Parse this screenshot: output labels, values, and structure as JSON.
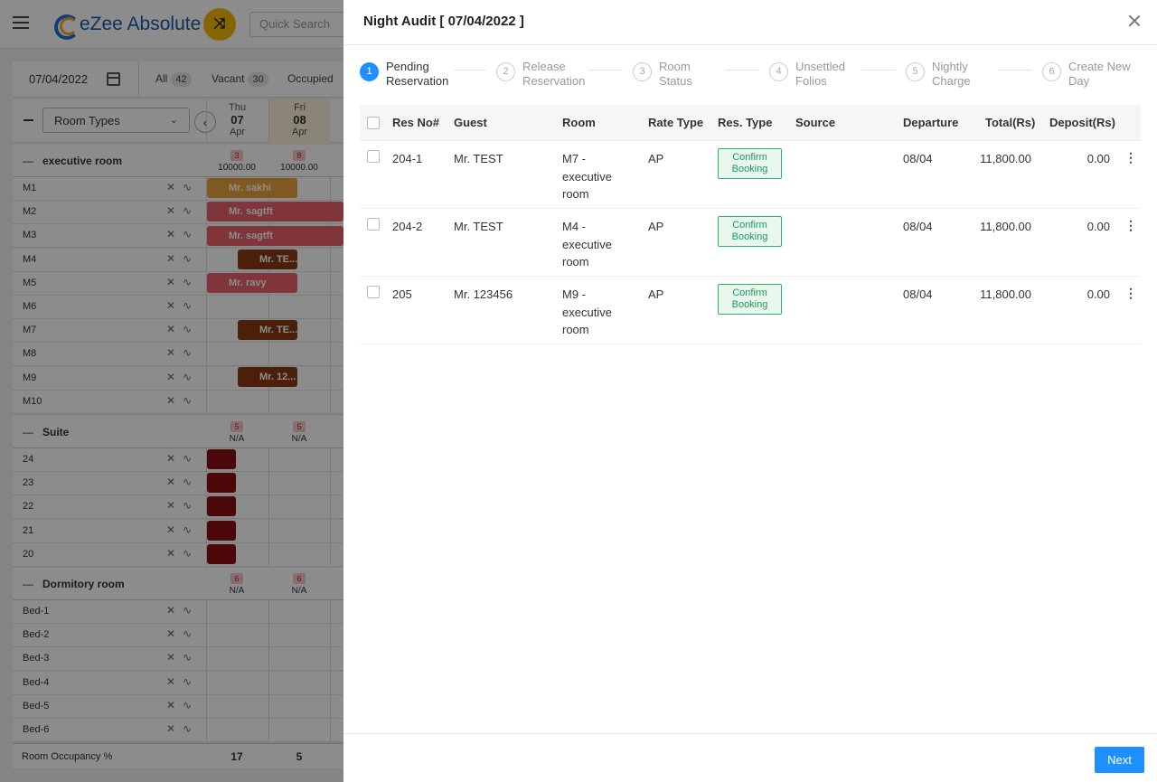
{
  "app": {
    "logo_text": "eZee Absolute",
    "search_placeholder": "Quick Search",
    "date": "07/04/2022",
    "filters": [
      {
        "label": "All",
        "count": "42"
      },
      {
        "label": "Vacant",
        "count": "30"
      },
      {
        "label": "Occupied",
        "count": ""
      }
    ],
    "room_types_select": "Room Types",
    "days": [
      {
        "dow": "Thu",
        "day": "07",
        "mon": "Apr"
      },
      {
        "dow": "Fri",
        "day": "08",
        "mon": "Apr"
      }
    ],
    "categories": [
      {
        "name": "executive room",
        "cells": [
          {
            "badge": "3",
            "value": "10000.00"
          },
          {
            "badge": "8",
            "value": "10000.00"
          }
        ]
      },
      {
        "name": "Suite",
        "cells": [
          {
            "badge": "5",
            "value": "N/A"
          },
          {
            "badge": "5",
            "value": "N/A"
          }
        ]
      },
      {
        "name": "Dormitory room",
        "cells": [
          {
            "badge": "6",
            "value": "N/A"
          },
          {
            "badge": "6",
            "value": "N/A"
          }
        ]
      }
    ],
    "rooms_exec": [
      "M1",
      "M2",
      "M3",
      "M4",
      "M5",
      "M6",
      "M7",
      "M8",
      "M9",
      "M10"
    ],
    "rooms_suite": [
      "24",
      "23",
      "22",
      "21",
      "20"
    ],
    "rooms_dorm": [
      "Bed-1",
      "Bed-2",
      "Bed-3",
      "Bed-4",
      "Bed-5",
      "Bed-6"
    ],
    "bookings": [
      {
        "guest": "Mr. sakhi"
      },
      {
        "guest": "Mr. sagtft"
      },
      {
        "guest": "Mr. sagtft"
      },
      {
        "guest": "Mr. TE..."
      },
      {
        "guest": "Mr. ravy"
      },
      {
        "guest": "Mr. TE..."
      },
      {
        "guest": "Mr. 12..."
      }
    ],
    "occupancy_label": "Room Occupancy %",
    "occupancy_values": [
      "17",
      "5"
    ]
  },
  "drawer": {
    "title": "Night Audit [ 07/04/2022 ]",
    "steps": [
      {
        "num": "1",
        "label": "Pending Reservation"
      },
      {
        "num": "2",
        "label": "Release Reservation"
      },
      {
        "num": "3",
        "label": "Room Status"
      },
      {
        "num": "4",
        "label": "Unsettled Folios"
      },
      {
        "num": "5",
        "label": "Nightly Charge"
      },
      {
        "num": "6",
        "label": "Create New Day"
      }
    ],
    "columns": [
      "Res No#",
      "Guest",
      "Room",
      "Rate Type",
      "Res. Type",
      "Source",
      "Departure",
      "Total(Rs)",
      "Deposit(Rs)"
    ],
    "rows": [
      {
        "res_no": "204-1",
        "guest": "Mr. TEST",
        "room": "M7 - executive room",
        "rate_type": "AP",
        "res_type": "Confirm Booking",
        "source": "",
        "departure": "08/04",
        "total": "11,800.00",
        "deposit": "0.00"
      },
      {
        "res_no": "204-2",
        "guest": "Mr. TEST",
        "room": "M4 - executive room",
        "rate_type": "AP",
        "res_type": "Confirm Booking",
        "source": "",
        "departure": "08/04",
        "total": "11,800.00",
        "deposit": "0.00"
      },
      {
        "res_no": "205",
        "guest": "Mr. 123456",
        "room": "M9 - executive room",
        "rate_type": "AP",
        "res_type": "Confirm Booking",
        "source": "",
        "departure": "08/04",
        "total": "11,800.00",
        "deposit": "0.00"
      }
    ],
    "next_label": "Next"
  },
  "colors": {
    "accent": "#1e90ff",
    "confirm_badge": "#2db36b",
    "overlay": "#000000"
  }
}
